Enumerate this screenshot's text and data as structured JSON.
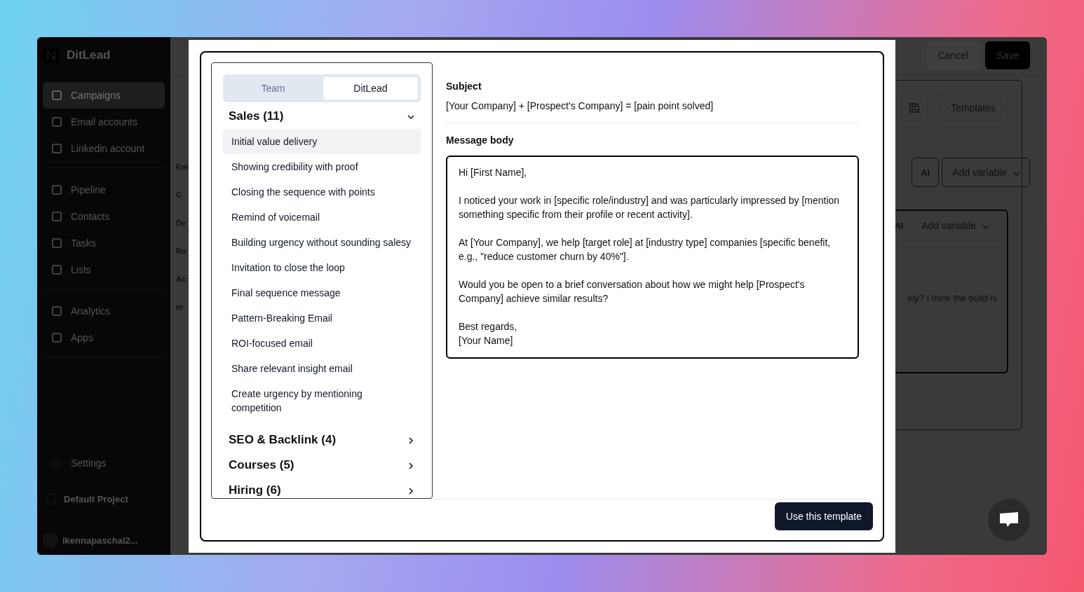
{
  "sidebar": {
    "brand": "DitLead",
    "nav_groups": [
      [
        {
          "label": "Campaigns",
          "selected": true
        },
        {
          "label": "Email accounts",
          "selected": false
        },
        {
          "label": "Linkedin account",
          "selected": false
        }
      ],
      [
        {
          "label": "Pipeline",
          "selected": false
        },
        {
          "label": "Contacts",
          "selected": false
        },
        {
          "label": "Tasks",
          "selected": false
        },
        {
          "label": "Lists",
          "selected": false
        }
      ],
      [
        {
          "label": "Analytics",
          "selected": false
        },
        {
          "label": "Apps",
          "selected": false
        }
      ]
    ],
    "settings": "Settings",
    "project": "Default Project",
    "user": "ikennapaschal2..."
  },
  "background_column": [
    "Em",
    "C",
    "De",
    "Ro",
    "Ac",
    "m"
  ],
  "header_actions": {
    "cancel": "Cancel",
    "save": "Save"
  },
  "editor": {
    "templates_button": "Templates",
    "subject_toolbar": {
      "ai": "AI",
      "add_variable": "Add variable"
    },
    "body_toolbar": {
      "ai": "AI",
      "add_variable": "Add variable"
    },
    "body_text": "ely? I think the build is"
  },
  "template_modal": {
    "tabs": [
      {
        "label": "Team",
        "selected": false
      },
      {
        "label": "DitLead",
        "selected": true
      }
    ],
    "categories": [
      {
        "title": "Sales (11)",
        "expanded": true,
        "templates": [
          {
            "label": "Initial value delivery",
            "selected": true
          },
          {
            "label": "Showing credibility with proof",
            "selected": false
          },
          {
            "label": "Closing the sequence with points",
            "selected": false
          },
          {
            "label": "Remind of voicemail",
            "selected": false
          },
          {
            "label": "Building urgency without sounding salesy",
            "selected": false
          },
          {
            "label": "Invitation to close the loop",
            "selected": false
          },
          {
            "label": "Final sequence message",
            "selected": false
          },
          {
            "label": "Pattern-Breaking Email",
            "selected": false
          },
          {
            "label": "ROI-focused email",
            "selected": false
          },
          {
            "label": "Share relevant insight email",
            "selected": false
          },
          {
            "label": "Create urgency by mentioning competition",
            "selected": false
          }
        ]
      },
      {
        "title": "SEO & Backlink (4)",
        "expanded": false
      },
      {
        "title": "Courses (5)",
        "expanded": false
      },
      {
        "title": "Hiring (6)",
        "expanded": false
      }
    ],
    "subject_label": "Subject",
    "subject": "[Your Company] + [Prospect's Company] = [pain point solved]",
    "body_label": "Message body",
    "body": [
      "Hi [First Name],",
      "I noticed your work in [specific role/industry] and was particularly impressed by [mention something specific from their profile or recent activity].",
      "At [Your Company], we help [target role] at [industry type] companies [specific benefit, e.g., \"reduce customer churn by 40%\"].",
      "Would you be open to a brief conversation about how we might help [Prospect's Company] achieve similar results?",
      "Best regards,\n[Your Name]"
    ],
    "use_button": "Use this template"
  }
}
